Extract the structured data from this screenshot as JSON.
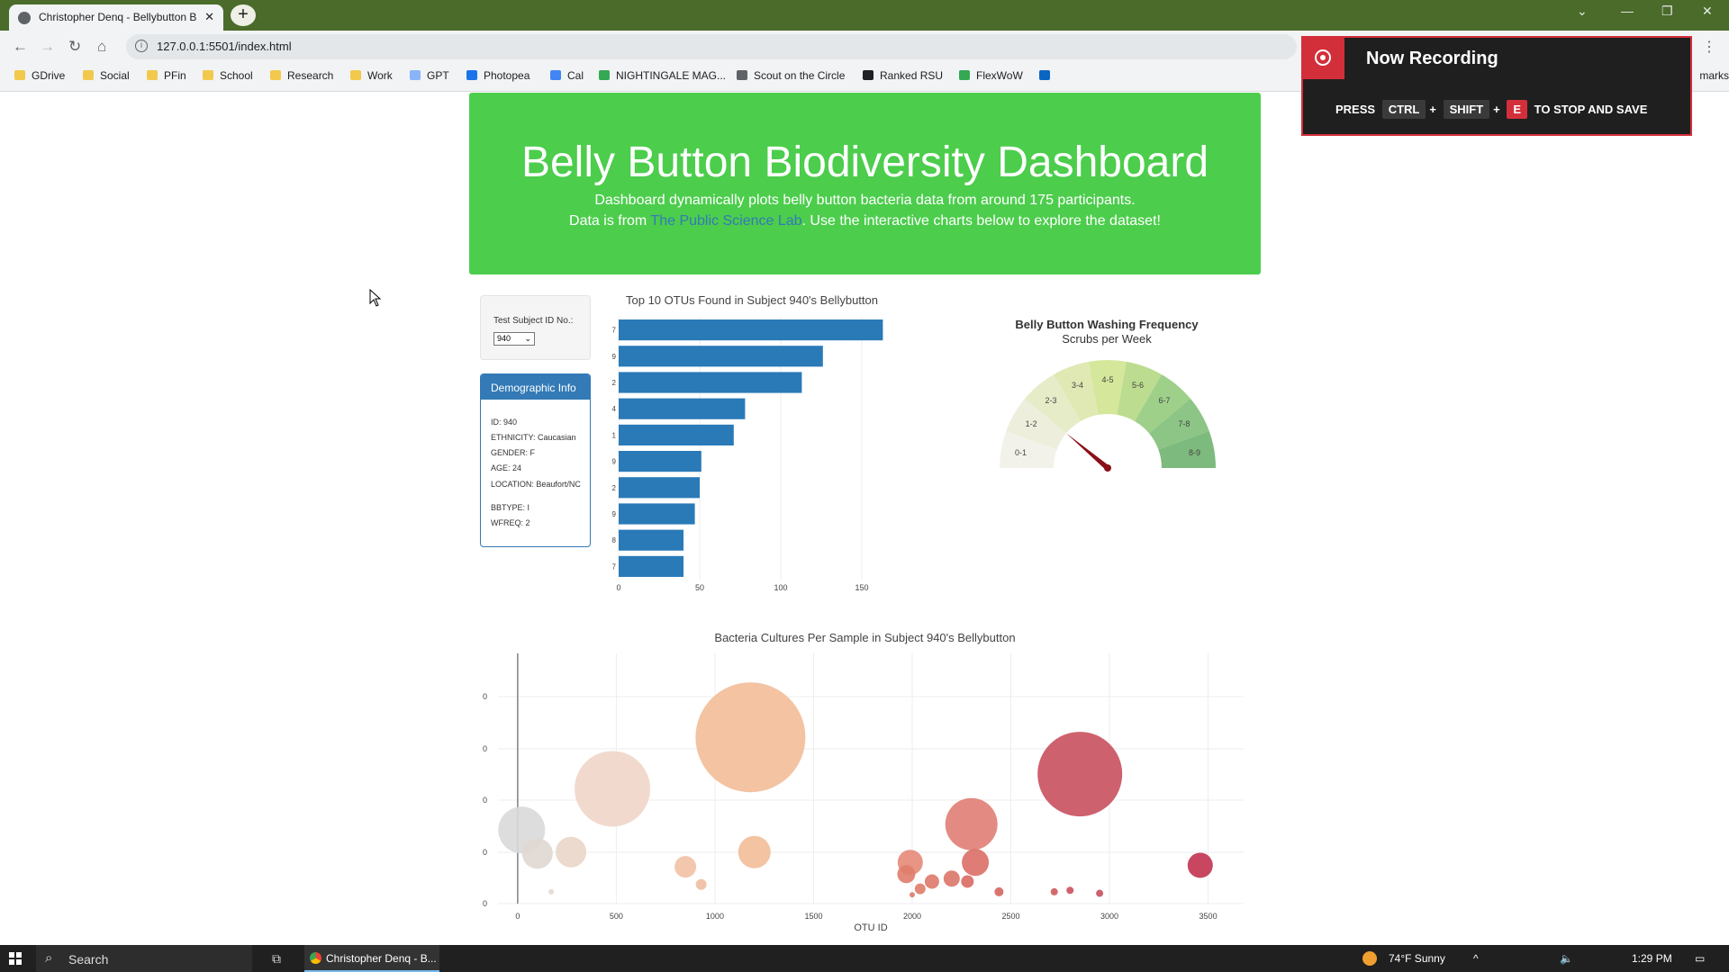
{
  "browser": {
    "tab_title": "Christopher Denq - Bellybutton B",
    "new_tab": "+",
    "url": "127.0.0.1:5501/index.html",
    "bookmarks": [
      "GDrive",
      "Social",
      "PFin",
      "School",
      "Research",
      "Work",
      "GPT",
      "Photopea",
      "Cal",
      "NIGHTINGALE MAG...",
      "Scout on the Circle",
      "Ranked RSU",
      "FlexWoW"
    ],
    "bookmarks_end": "marks"
  },
  "header": {
    "title": "Belly Button Biodiversity Dashboard",
    "line1": "Dashboard dynamically plots belly button bacteria data from around 175 participants.",
    "line2_prefix": "Data is from ",
    "link_text": "The Public Science Lab",
    "line2_suffix": ". Use the interactive charts below to explore the dataset!"
  },
  "selector": {
    "label": "Test Subject ID No.:",
    "value": "940"
  },
  "demographics": {
    "title": "Demographic Info",
    "rows": [
      "ID: 940",
      "ETHNICITY: Caucasian",
      "GENDER: F",
      "AGE: 24",
      "LOCATION: Beaufort/NC",
      "BBTYPE: I",
      "WFREQ: 2"
    ]
  },
  "recording": {
    "title": "Now Recording",
    "press": "PRESS",
    "keys": [
      "CTRL",
      "SHIFT",
      "E"
    ],
    "plus": "+",
    "suffix": "TO STOP AND SAVE"
  },
  "taskbar": {
    "search": "Search",
    "app": "Christopher Denq - B...",
    "weather": "74°F  Sunny",
    "time": "1:29 PM"
  },
  "chart_data": [
    {
      "type": "bar",
      "orientation": "horizontal",
      "title": "Top 10 OTUs Found in Subject 940's Bellybutton",
      "categories": [
        "7",
        "9",
        "2",
        "4",
        "1",
        "9",
        "2",
        "9",
        "8",
        "7"
      ],
      "values": [
        163,
        126,
        113,
        78,
        71,
        51,
        50,
        47,
        40,
        40
      ],
      "xticks": [
        "0",
        "50",
        "100",
        "150"
      ],
      "xlim": [
        0,
        170
      ],
      "color": "#2a7ab8"
    },
    {
      "type": "gauge",
      "title": "Belly Button Washing Frequency",
      "subtitle": "Scrubs per Week",
      "range": [
        0,
        9
      ],
      "value": 2,
      "steps": [
        "0-1",
        "1-2",
        "2-3",
        "3-4",
        "4-5",
        "5-6",
        "6-7",
        "7-8",
        "8-9"
      ],
      "step_colors": [
        "#f3f2ea",
        "#eeeedc",
        "#e6ecc8",
        "#e0e8b4",
        "#d4e79a",
        "#bcdc8f",
        "#9fd08a",
        "#8cc585",
        "#7dba7d"
      ],
      "needle_color": "#8b0f17"
    },
    {
      "type": "scatter",
      "title": "Bacteria Cultures Per Sample in Subject 940's Bellybutton",
      "xlabel": "OTU ID",
      "xticks": [
        "0",
        "500",
        "1000",
        "1500",
        "2000",
        "2500",
        "3000",
        "3500"
      ],
      "yticks": [
        "0",
        "0",
        "0",
        "0",
        "0"
      ],
      "xlim": [
        -100,
        3680
      ],
      "ylim": [
        0,
        170
      ],
      "points": [
        {
          "x": 20,
          "y": 50,
          "r": 26,
          "color": "#d9d9d9"
        },
        {
          "x": 100,
          "y": 34,
          "r": 17,
          "color": "#e0d8d2"
        },
        {
          "x": 270,
          "y": 35,
          "r": 17,
          "color": "#e9d6c8"
        },
        {
          "x": 480,
          "y": 78,
          "r": 42,
          "color": "#f0d6c8"
        },
        {
          "x": 850,
          "y": 25,
          "r": 12,
          "color": "#f2c1a4"
        },
        {
          "x": 930,
          "y": 13,
          "r": 6,
          "color": "#f0bca0"
        },
        {
          "x": 1180,
          "y": 113,
          "r": 61,
          "color": "#f2bc98"
        },
        {
          "x": 1200,
          "y": 35,
          "r": 18,
          "color": "#f2bc98"
        },
        {
          "x": 1990,
          "y": 28,
          "r": 14,
          "color": "#e58a78"
        },
        {
          "x": 1970,
          "y": 20,
          "r": 10,
          "color": "#e07c6c"
        },
        {
          "x": 2040,
          "y": 10,
          "r": 6,
          "color": "#e07c6c"
        },
        {
          "x": 2100,
          "y": 15,
          "r": 8,
          "color": "#de7a6a"
        },
        {
          "x": 2200,
          "y": 17,
          "r": 9,
          "color": "#dc7468"
        },
        {
          "x": 2280,
          "y": 15,
          "r": 7,
          "color": "#d96a62"
        },
        {
          "x": 2300,
          "y": 54,
          "r": 29,
          "color": "#e07e74"
        },
        {
          "x": 2320,
          "y": 28,
          "r": 15,
          "color": "#da6e66"
        },
        {
          "x": 2440,
          "y": 8,
          "r": 5,
          "color": "#d5665e"
        },
        {
          "x": 2720,
          "y": 8,
          "r": 4,
          "color": "#cf5a5a"
        },
        {
          "x": 2850,
          "y": 88,
          "r": 47,
          "color": "#c9505e"
        },
        {
          "x": 2950,
          "y": 7,
          "r": 4,
          "color": "#c9505e"
        },
        {
          "x": 3460,
          "y": 26,
          "r": 14,
          "color": "#c2324e"
        },
        {
          "x": 2000,
          "y": 6,
          "r": 3,
          "color": "#e07c6c"
        },
        {
          "x": 2800,
          "y": 9,
          "r": 4,
          "color": "#c9505e"
        },
        {
          "x": 170,
          "y": 8,
          "r": 3,
          "color": "#e0d8d2"
        }
      ]
    }
  ]
}
